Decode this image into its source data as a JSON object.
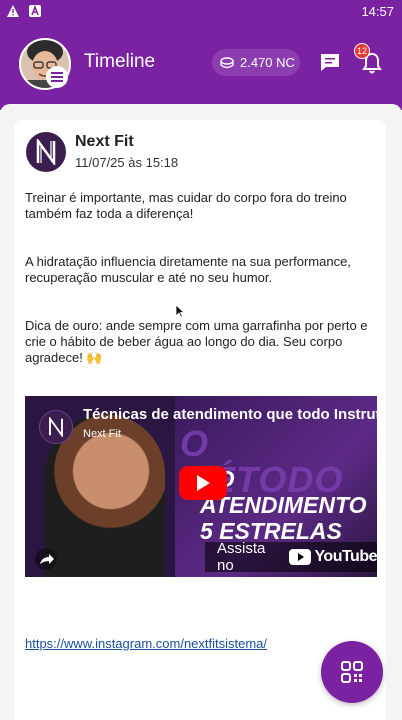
{
  "status_bar": {
    "time": "14:57",
    "icons": [
      "warning-icon",
      "notification-a-icon"
    ]
  },
  "header": {
    "title": "Timeline",
    "coins": "2.470 NC",
    "notification_count": "12",
    "icons": [
      "chat-icon",
      "bell-icon",
      "coin-icon",
      "menu-icon"
    ]
  },
  "post": {
    "author": "Next Fit",
    "date": "11/07/25 às 15:18",
    "paragraphs": [
      "Treinar é importante, mas cuidar do corpo fora do treino também faz toda a diferença!",
      "A hidratação influencia diretamente na sua performance, recuperação muscular e até no seu humor.",
      "Dica de ouro: ande sempre com uma garrafinha por perto e crie o hábito de beber água ao longo do dia. Seu corpo agradece! 🙌"
    ],
    "video": {
      "title": "Técnicas de atendimento que todo Instrutor",
      "channel": "Next Fit",
      "overlay_text_1": "O MÉTODO",
      "overlay_text_2": "DO ATENDIMENTO",
      "overlay_text_3": "5 ESTRELAS",
      "watch_on": "Assista no",
      "platform": "YouTube"
    },
    "link": "https://www.instagram.com/nextfitsistema/"
  },
  "colors": {
    "brand": "#7b22a3",
    "link": "#1a4f99",
    "youtube": "#ff0000"
  }
}
